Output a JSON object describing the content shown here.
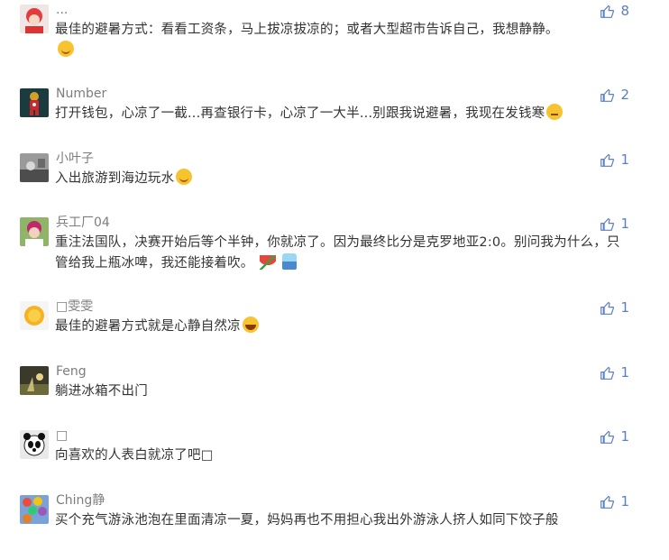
{
  "comments": [
    {
      "username": "...",
      "likes": "8",
      "text": "最佳的避暑方式：看看工资条，马上拔凉拔凉的；或者大型超市告诉自己，我想静静。",
      "emoji": [
        "smile"
      ],
      "avatar": "avatar-red-girl"
    },
    {
      "username": "Number",
      "likes": "2",
      "text": "打开钱包，心凉了一截...再查银行卡，心凉了一大半...别跟我说避暑，我现在发钱寒",
      "emoji": [
        "tired"
      ],
      "avatar": "avatar-ironman"
    },
    {
      "username": "小叶子",
      "likes": "1",
      "text": "入出旅游到海边玩水",
      "emoji": [
        "smile"
      ],
      "avatar": "avatar-grey-photo"
    },
    {
      "username": "兵工厂04",
      "likes": "1",
      "text": "重注法国队，决赛开始后等个半钟，你就凉了。因为最终比分是克罗地亚2:0。别问我为什么，只管给我上瓶冰啤，我还能接着吹。",
      "emoji": [
        "watermelon",
        "shaveice"
      ],
      "avatar": "avatar-child"
    },
    {
      "username": "□雯雯",
      "likes": "1",
      "text": "最佳的避暑方式就是心静自然凉",
      "emoji": [
        "laugh"
      ],
      "avatar": "avatar-sun"
    },
    {
      "username": "Feng",
      "likes": "1",
      "text": "躺进冰箱不出门",
      "emoji": [],
      "avatar": "avatar-dusk"
    },
    {
      "username": "□",
      "likes": "1",
      "text": "向喜欢的人表白就凉了吧□",
      "emoji": [],
      "avatar": "avatar-panda"
    },
    {
      "username": "Ching静",
      "likes": "1",
      "text": "买个充气游泳池泡在里面清凉一夏，妈妈再也不用担心我出外游泳人挤人如同下饺子般",
      "emoji": [],
      "avatar": "avatar-balloons"
    }
  ],
  "colors": {
    "username": "#7d7d7d",
    "text": "#333333",
    "like": "#5b7fc0"
  }
}
